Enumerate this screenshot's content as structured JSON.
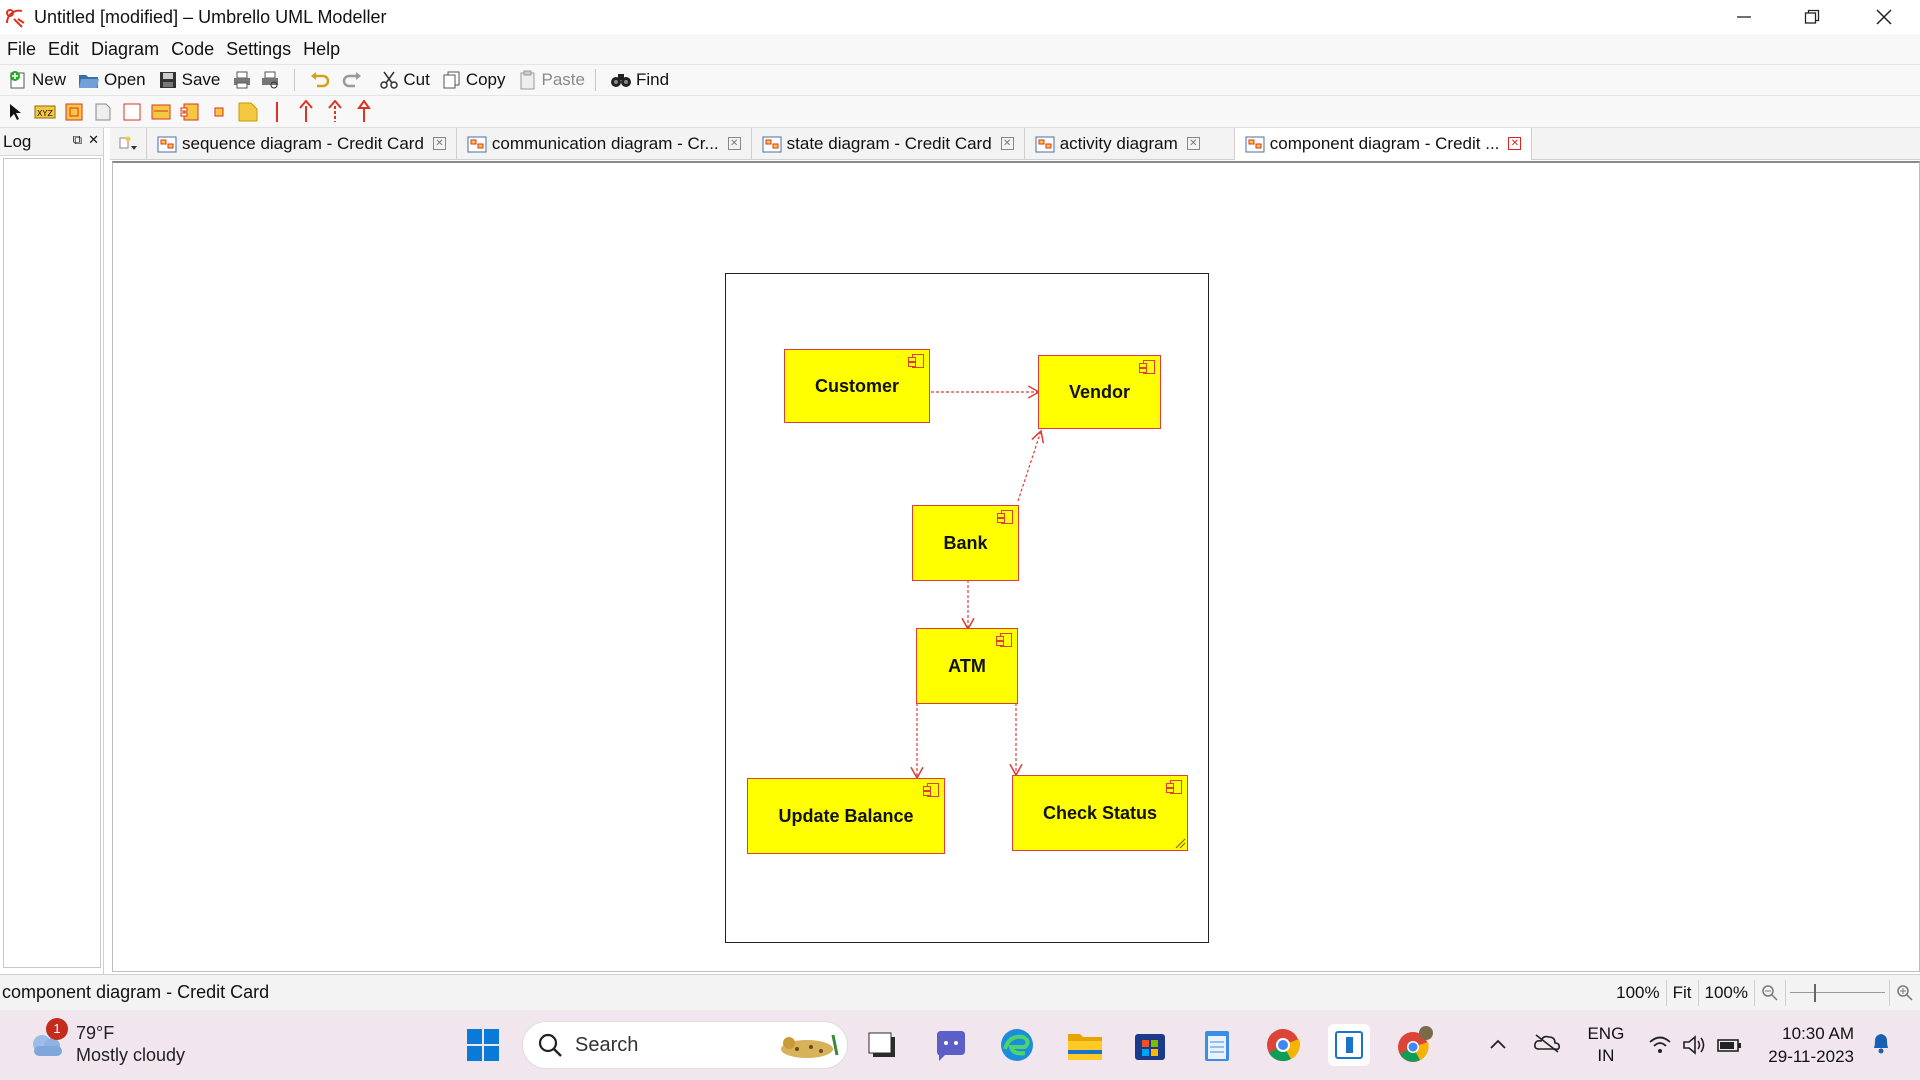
{
  "window": {
    "title": "Untitled [modified] – Umbrello UML Modeller"
  },
  "menu": [
    "File",
    "Edit",
    "Diagram",
    "Code",
    "Settings",
    "Help"
  ],
  "toolbar": {
    "new_label": "New",
    "open_label": "Open",
    "save_label": "Save",
    "cut_label": "Cut",
    "copy_label": "Copy",
    "paste_label": "Paste",
    "find_label": "Find"
  },
  "log": {
    "title": "Log"
  },
  "tabs": [
    {
      "label": "sequence diagram - Credit Card"
    },
    {
      "label": "communication diagram -  Cr..."
    },
    {
      "label": "state diagram - Credit Card"
    },
    {
      "label": "activity diagram"
    },
    {
      "label": "component diagram - Credit ..."
    }
  ],
  "active_tab": 4,
  "diagram": {
    "components": {
      "customer": "Customer",
      "vendor": "Vendor",
      "bank": "Bank",
      "atm": "ATM",
      "update_balance": "Update Balance",
      "check_status": "Check Status"
    },
    "dependencies": [
      {
        "from": "Customer",
        "to": "Vendor"
      },
      {
        "from": "Bank",
        "to": "Vendor"
      },
      {
        "from": "Bank",
        "to": "ATM"
      },
      {
        "from": "ATM",
        "to": "Update Balance"
      },
      {
        "from": "ATM",
        "to": "Check Status"
      }
    ],
    "colors": {
      "fill": "#ffff00",
      "border": "#e03c3c"
    }
  },
  "statusbar": {
    "text": "component diagram - Credit Card",
    "zoom_value": "100%",
    "fit_label": "Fit",
    "zoom_box": "100%"
  },
  "taskbar": {
    "weather_temp": "79°F",
    "weather_desc": "Mostly cloudy",
    "weather_badge": "1",
    "search_placeholder": "Search",
    "lang_top": "ENG",
    "lang_bottom": "IN",
    "time": "10:30 AM",
    "date": "29-11-2023"
  }
}
